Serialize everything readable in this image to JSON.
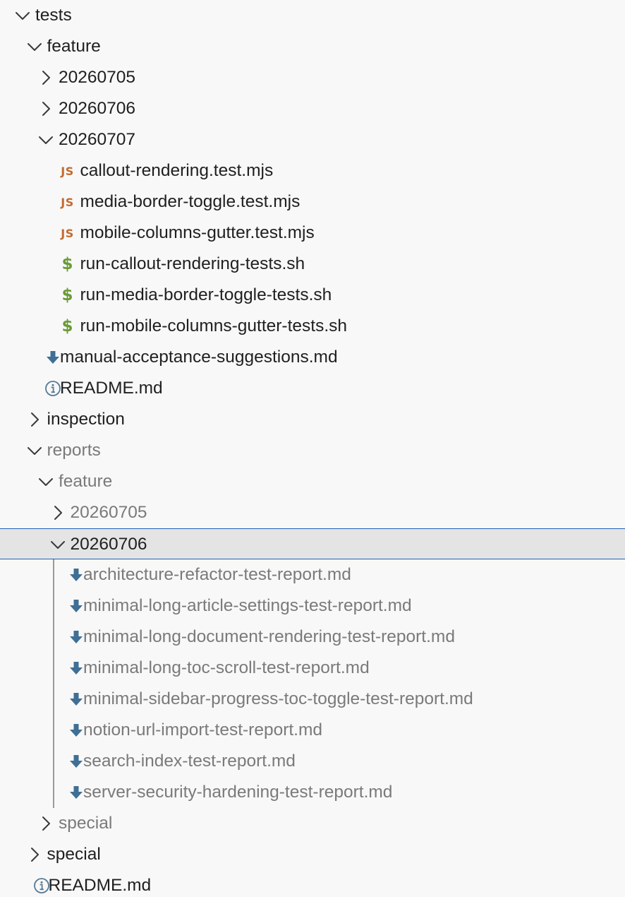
{
  "tree": {
    "rows": [
      {
        "label": "tests",
        "twisty": "chevron-down",
        "depth": 0,
        "icon": null,
        "dim": false
      },
      {
        "label": "feature",
        "twisty": "chevron-down",
        "depth": 1,
        "icon": null,
        "dim": false
      },
      {
        "label": "20260705",
        "twisty": "chevron-right",
        "depth": 2,
        "icon": null,
        "dim": false
      },
      {
        "label": "20260706",
        "twisty": "chevron-right",
        "depth": 2,
        "icon": null,
        "dim": false
      },
      {
        "label": "20260707",
        "twisty": "chevron-down",
        "depth": 2,
        "icon": null,
        "dim": false
      },
      {
        "label": "callout-rendering.test.mjs",
        "twisty": null,
        "depth": 3,
        "icon": "javascript-file-icon",
        "glyph": "JS",
        "dim": false
      },
      {
        "label": "media-border-toggle.test.mjs",
        "twisty": null,
        "depth": 3,
        "icon": "javascript-file-icon",
        "glyph": "JS",
        "dim": false
      },
      {
        "label": "mobile-columns-gutter.test.mjs",
        "twisty": null,
        "depth": 3,
        "icon": "javascript-file-icon",
        "glyph": "JS",
        "dim": false
      },
      {
        "label": "run-callout-rendering-tests.sh",
        "twisty": null,
        "depth": 3,
        "icon": "shell-script-icon",
        "glyph": "$",
        "dim": false
      },
      {
        "label": "run-media-border-toggle-tests.sh",
        "twisty": null,
        "depth": 3,
        "icon": "shell-script-icon",
        "glyph": "$",
        "dim": false
      },
      {
        "label": "run-mobile-columns-gutter-tests.sh",
        "twisty": null,
        "depth": 3,
        "icon": "shell-script-icon",
        "glyph": "$",
        "dim": false
      },
      {
        "label": "manual-acceptance-suggestions.md",
        "twisty": null,
        "depth": 2,
        "icon": "markdown-download-icon",
        "dim": false
      },
      {
        "label": "README.md",
        "twisty": null,
        "depth": 2,
        "icon": "info-circle-icon",
        "dim": false
      },
      {
        "label": "inspection",
        "twisty": "chevron-right",
        "depth": 1,
        "icon": null,
        "dim": false
      },
      {
        "label": "reports",
        "twisty": "chevron-down",
        "depth": 1,
        "icon": null,
        "dim": true
      },
      {
        "label": "feature",
        "twisty": "chevron-down",
        "depth": 2,
        "icon": null,
        "dim": true
      },
      {
        "label": "20260705",
        "twisty": "chevron-right",
        "depth": 3,
        "icon": null,
        "dim": true
      },
      {
        "label": "20260706",
        "twisty": "chevron-down",
        "depth": 3,
        "icon": null,
        "dim": false,
        "selected": true
      },
      {
        "label": "architecture-refactor-test-report.md",
        "twisty": null,
        "depth": 4,
        "icon": "markdown-download-icon",
        "dim": true
      },
      {
        "label": "minimal-long-article-settings-test-report.md",
        "twisty": null,
        "depth": 4,
        "icon": "markdown-download-icon",
        "dim": true
      },
      {
        "label": "minimal-long-document-rendering-test-report.md",
        "twisty": null,
        "depth": 4,
        "icon": "markdown-download-icon",
        "dim": true
      },
      {
        "label": "minimal-long-toc-scroll-test-report.md",
        "twisty": null,
        "depth": 4,
        "icon": "markdown-download-icon",
        "dim": true
      },
      {
        "label": "minimal-sidebar-progress-toc-toggle-test-report.md",
        "twisty": null,
        "depth": 4,
        "icon": "markdown-download-icon",
        "dim": true
      },
      {
        "label": "notion-url-import-test-report.md",
        "twisty": null,
        "depth": 4,
        "icon": "markdown-download-icon",
        "dim": true
      },
      {
        "label": "search-index-test-report.md",
        "twisty": null,
        "depth": 4,
        "icon": "markdown-download-icon",
        "dim": true
      },
      {
        "label": "server-security-hardening-test-report.md",
        "twisty": null,
        "depth": 4,
        "icon": "markdown-download-icon",
        "dim": true
      },
      {
        "label": "special",
        "twisty": "chevron-right",
        "depth": 2,
        "icon": null,
        "dim": true
      },
      {
        "label": "special",
        "twisty": "chevron-right",
        "depth": 1,
        "icon": null,
        "dim": false
      },
      {
        "label": "README.md",
        "twisty": null,
        "depth": 1,
        "icon": "info-circle-icon",
        "dim": false
      }
    ]
  },
  "colors": {
    "background": "#f8f8f8",
    "selected_background": "#e4e4e4",
    "focus_border": "#1f5fb6",
    "text": "#1f1f1f",
    "dim_text": "#7a7a7a",
    "js_icon": "#c46a2e",
    "shell_icon": "#6a9a37",
    "markdown_icon": "#3f6f94",
    "info_icon": "#557a96",
    "chevron": "#3a3a3a"
  }
}
